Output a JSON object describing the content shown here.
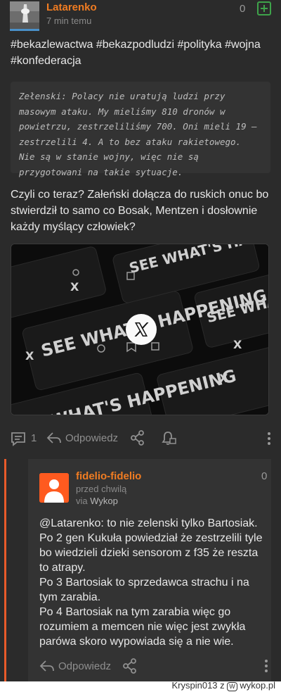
{
  "post": {
    "author": "Latarenko",
    "time": "7 min temu",
    "votes": "0",
    "tags": "#bekazlewactwa #bekazpodludzi #polityka #wojna #konfederacja",
    "quote": "Zełenski: Polacy nie uratują ludzi przy masowym ataku. My mieliśmy 810 dronów w powietrzu, zestrzeliliśmy 700. Oni mieli 19 – zestrzelili 4. A to bez ataku rakietowego. Nie są w stanie wojny, więc nie są przygotowani na takie sytuacje.",
    "body": "Czyli co teraz? Załeński dołącza do ruskich onuc bo stwierdził to samo co Bosak, Mentzen i dosłownie każdy myślący człowiek?",
    "embed_text": "SEE WHAT'S HAPPENING",
    "comment_count": "1",
    "reply_label": "Odpowiedz"
  },
  "reply": {
    "author": "fidelio-fidelio",
    "time": "przed chwilą",
    "via_prefix": "via",
    "via_app": "Wykop",
    "votes": "0",
    "mention": "@Latarenko",
    "body_lines": [
      ": to nie zelenski tylko Bartosiak.",
      "Po 2 gen Kukuła powiedział że zestrzelili tyle bo wiedzieli dzieki sensorom z f35 że reszta to atrapy.",
      "Po 3 Bartosiak to sprzedawca strachu i na tym zarabia.",
      "Po 4 Bartosiak na tym zarabia więc go rozumiem a memcen nie więc jest zwykła parówa skoro wypowiada się a nie wie."
    ],
    "reply_label": "Odpowiedz"
  },
  "footer": {
    "user": "Kryspin013",
    "separator": "z",
    "site": "wykop.pl"
  }
}
